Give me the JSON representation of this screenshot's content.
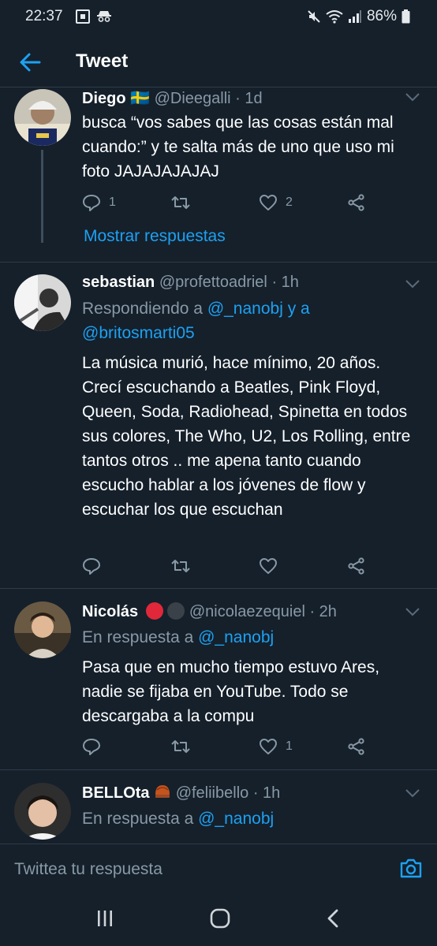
{
  "status_bar": {
    "time": "22:37",
    "battery": "86%"
  },
  "header": {
    "title": "Tweet"
  },
  "tweets": [
    {
      "name": "Diego",
      "flag": "🇸🇪",
      "handle": "@Dieegalli",
      "time": "· 1d",
      "text": "busca “vos sabes que las cosas están mal cuando:” y te salta más de uno que uso mi foto JAJAJAJAJAJ",
      "reply_count": "1",
      "retweet_count": "",
      "like_count": "2",
      "show_replies": "Mostrar respuestas"
    },
    {
      "name": "sebastian",
      "handle": "@profettoadriel",
      "time": "· 1h",
      "replying_label": "Respondiendo a",
      "replying_users_1": "@_nanobj y a",
      "replying_users_2": "@britosmarti05",
      "text": "La música murió, hace mínimo, 20 años. Crecí escuchando a Beatles, Pink Floyd, Queen, Soda, Radiohead, Spinetta en todos sus colores, The Who, U2, Los Rolling, entre tantos otros .. me apena tanto cuando escucho hablar a los jóvenes de flow y escuchar los que escuchan",
      "reply_count": "",
      "retweet_count": "",
      "like_count": ""
    },
    {
      "name": "Nicolás",
      "handle": "@nicolaezequiel",
      "time": "· 2h",
      "replying_label": "En respuesta a",
      "replying_users_1": "@_nanobj",
      "text": "Pasa que en mucho tiempo estuvo Ares, nadie se fijaba en YouTube. Todo se descargaba a la compu",
      "reply_count": "",
      "retweet_count": "",
      "like_count": "1"
    },
    {
      "name": "BELLOta",
      "handle": "@feliibello",
      "time": "· 1h",
      "replying_label": "En respuesta a",
      "replying_users_1": "@_nanobj"
    }
  ],
  "composer": {
    "placeholder": "Twittea tu respuesta"
  },
  "colors": {
    "background": "#15202b",
    "accent": "#1da1f2",
    "muted": "#8899a6",
    "divider": "#2f3b47"
  }
}
